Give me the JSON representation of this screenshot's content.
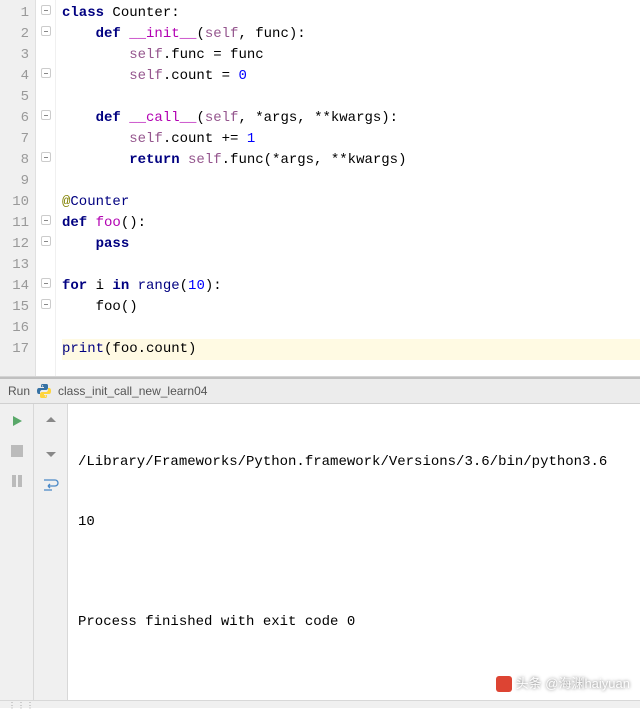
{
  "lines": [
    "1",
    "2",
    "3",
    "4",
    "5",
    "6",
    "7",
    "8",
    "9",
    "10",
    "11",
    "12",
    "13",
    "14",
    "15",
    "16",
    "17"
  ],
  "code": {
    "l1": {
      "kw1": "class",
      "name": " Counter:"
    },
    "l2": {
      "indent": "    ",
      "kw": "def ",
      "fn": "__init__",
      "params": "(",
      "self": "self",
      "rest": ", func):"
    },
    "l3": {
      "indent": "        ",
      "self": "self",
      "rest": ".func = func"
    },
    "l4": {
      "indent": "        ",
      "self": "self",
      "rest": ".count = ",
      "num": "0"
    },
    "l6": {
      "indent": "    ",
      "kw": "def ",
      "fn": "__call__",
      "params": "(",
      "self": "self",
      "rest": ", *args, **kwargs):"
    },
    "l7": {
      "indent": "        ",
      "self": "self",
      "rest": ".count += ",
      "num": "1"
    },
    "l8": {
      "indent": "        ",
      "kw": "return ",
      "self": "self",
      "rest": ".func(*args, **kwargs)"
    },
    "l10": {
      "at": "@",
      "deco": "Counter"
    },
    "l11": {
      "kw": "def ",
      "fn": "foo",
      "rest": "():"
    },
    "l12": {
      "indent": "    ",
      "kw": "pass"
    },
    "l14": {
      "kw1": "for ",
      "var": "i",
      "kw2": " in ",
      "builtin": "range",
      "rest": "(",
      "num": "10",
      "rest2": "):"
    },
    "l15": {
      "indent": "    ",
      "rest": "foo()"
    },
    "l17": {
      "builtin": "print",
      "rest": "(foo.count)"
    }
  },
  "run": {
    "label": "Run",
    "script": "class_init_call_new_learn04",
    "out1": "/Library/Frameworks/Python.framework/Versions/3.6/bin/python3.6",
    "out2": "10",
    "out3": "",
    "out4": "Process finished with exit code 0"
  },
  "watermark": "头条 @海渊haiyuan"
}
